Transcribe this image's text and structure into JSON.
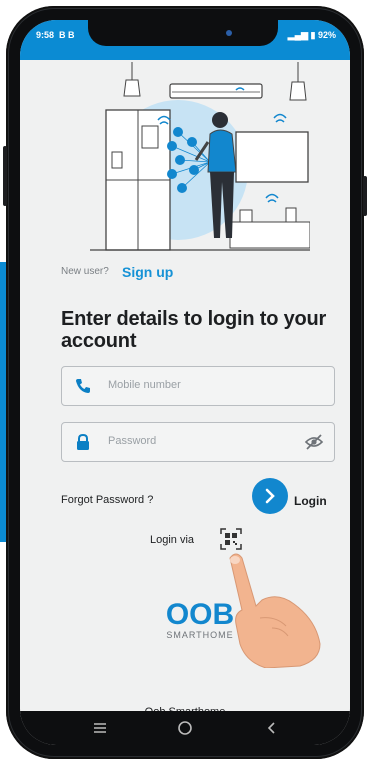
{
  "status_bar": {
    "time": "9:58",
    "left_icons": "B B",
    "battery": "92%"
  },
  "signup": {
    "prompt": "New user?",
    "link": "Sign up"
  },
  "heading": "Enter details to login to your account",
  "fields": {
    "mobile_placeholder": "Mobile number",
    "password_placeholder": "Password"
  },
  "actions": {
    "forgot": "Forgot Password ?",
    "login": "Login",
    "login_via": "Login via"
  },
  "logo": {
    "main": "OOB",
    "sub": "SMARTHOME"
  },
  "footer": "Oob Smarthome",
  "colors": {
    "accent": "#0b8bd3",
    "background": "#f0f1f1"
  },
  "icons": {
    "phone": "phone-icon",
    "lock": "lock-icon",
    "eye_off": "eye-off-icon",
    "qr": "qr-code-icon",
    "nav_menu": "menu-icon",
    "nav_home": "home-circle-icon",
    "nav_back": "back-chevron-icon"
  }
}
